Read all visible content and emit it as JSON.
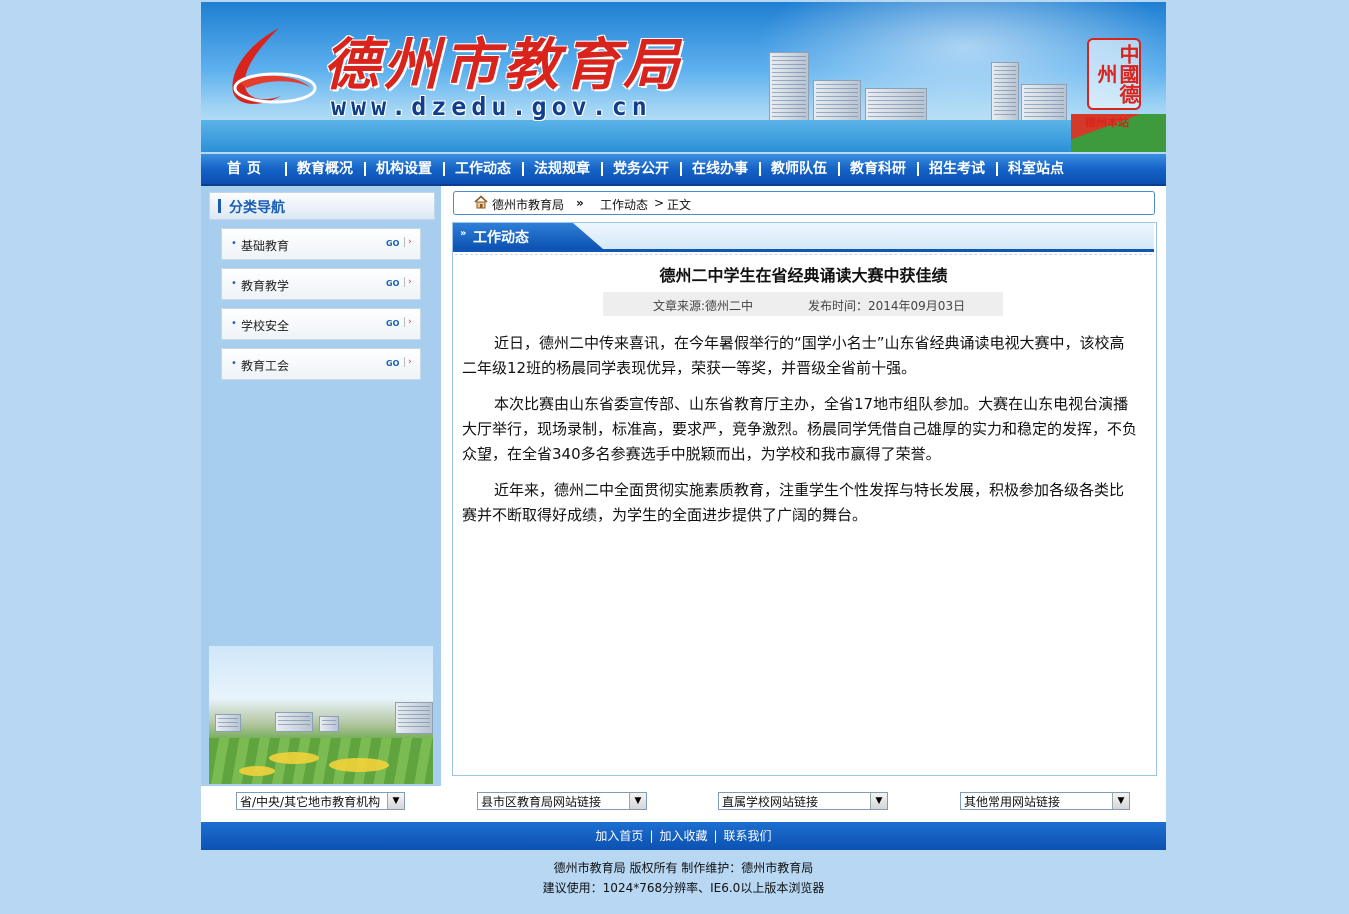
{
  "header": {
    "title": "德州市教育局",
    "url": "www.dzedu.gov.cn",
    "seal_text": "中國德州",
    "seal_caption": "德州本站"
  },
  "nav": {
    "items": [
      "首页",
      "教育概况",
      "机构设置",
      "工作动态",
      "法规规章",
      "党务公开",
      "在线办事",
      "教师队伍",
      "教育科研",
      "招生考试",
      "科室站点"
    ]
  },
  "sidebar": {
    "heading": "分类导航",
    "go_label": "GO",
    "items": [
      {
        "label": "基础教育"
      },
      {
        "label": "教育教学"
      },
      {
        "label": "学校安全"
      },
      {
        "label": "教育工会"
      }
    ]
  },
  "breadcrumb": {
    "home": "德州市教育局",
    "sep1": "»",
    "section": "工作动态",
    "sep2": ">",
    "current": "正文"
  },
  "section": {
    "title": "工作动态"
  },
  "article": {
    "title": "德州二中学生在省经典诵读大赛中获佳绩",
    "source": "文章来源:德州二中",
    "date": "发布时间：2014年09月03日",
    "paragraphs": [
      "近日，德州二中传来喜讯，在今年暑假举行的“国学小名士”山东省经典诵读电视大赛中，该校高二年级12班的杨晨同学表现优异，荣获一等奖，并晋级全省前十强。",
      "本次比赛由山东省委宣传部、山东省教育厅主办，全省17地市组队参加。大赛在山东电视台演播大厅举行，现场录制，标准高，要求严，竞争激烈。杨晨同学凭借自己雄厚的实力和稳定的发挥，不负众望，在全省340多名参赛选手中脱颖而出，为学校和我市赢得了荣誉。",
      "近年来，德州二中全面贯彻实施素质教育，注重学生个性发挥与特长发展，积极参加各级各类比赛并不断取得好成绩，为学生的全面进步提供了广阔的舞台。"
    ]
  },
  "links": {
    "selects": [
      "省/中央/其它地市教育机构",
      "县市区教育局网站链接",
      "直属学校网站链接",
      "其他常用网站链接"
    ]
  },
  "footer": {
    "links": [
      "加入首页",
      "加入收藏",
      "联系我们"
    ],
    "copyright": "德州市教育局 版权所有 制作维护：德州市教育局",
    "advice": "建议使用：1024*768分辨率、IE6.0以上版本浏览器"
  },
  "colors": {
    "nav_blue": "#1563c7",
    "title_red": "#d8241c",
    "page_bg": "#b7d7f2"
  }
}
